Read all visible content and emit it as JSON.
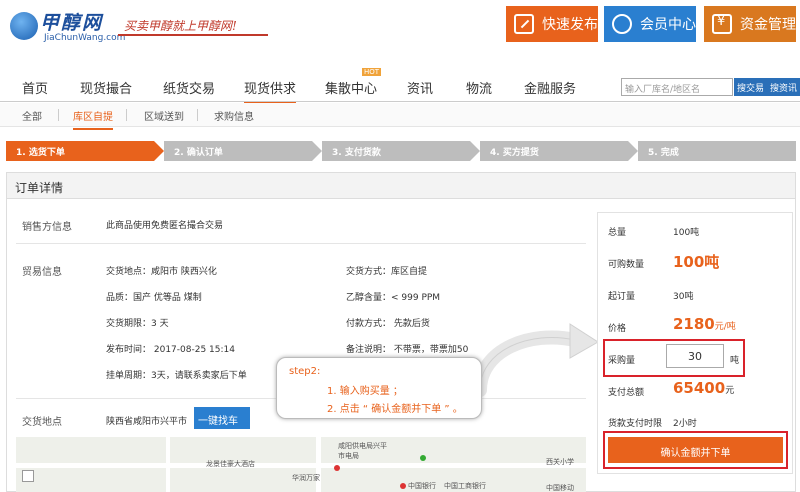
{
  "header": {
    "logo_text": "甲醇网",
    "logo_domain": "JiaChunWang.com",
    "slogan": "买卖甲醇就上甲醇网!",
    "buttons": [
      "快速发布",
      "会员中心",
      "资金管理"
    ]
  },
  "nav": {
    "items": [
      "首页",
      "现货撮合",
      "纸货交易",
      "现货供求",
      "集散中心",
      "资讯",
      "物流",
      "金融服务"
    ],
    "hot_badge": "HOT",
    "search_placeholder": "输入厂库名/地区名",
    "search_buttons": [
      "搜交易",
      "搜资讯"
    ]
  },
  "subnav": {
    "items": [
      "全部",
      "库区自提",
      "区域送到",
      "求购信息"
    ]
  },
  "steps": [
    "1. 选货下单",
    "2. 确认订单",
    "3. 支付货款",
    "4. 买方提货",
    "5. 完成"
  ],
  "order": {
    "title": "订单详情",
    "seller_label": "销售方信息",
    "seller_value": "此商品使用免费匿名撮合交易",
    "trade_label": "贸易信息",
    "fields_left": [
      "交货地点：咸阳市 陕西兴化",
      "品质：国产 优等品 煤制",
      "交货期限：3 天",
      "发布时间： 2017-08-25 15:14",
      "挂单周期：3天，请联系卖家后下单"
    ],
    "fields_right": [
      "交货方式：库区自提",
      "乙醇含量：< 999 PPM",
      "付款方式： 先款后货",
      "备注说明： 不带票，带票加50"
    ],
    "location_label": "交货地点",
    "location_value": "陕西省咸阳市兴平市",
    "find_car": "一键找车"
  },
  "map": {
    "labels": [
      "龙景佳豪大酒店",
      "咸阳供电局兴平市电局",
      "华润万家",
      "中国银行",
      "中国工商银行",
      "西关小学",
      "中国移动"
    ]
  },
  "callout": {
    "title": "step2:",
    "line1": "1. 输入购买量 ；",
    "line2": "2. 点击 “ 确认金额并下单 ” 。"
  },
  "summary": {
    "total_label": "总量",
    "total_value": "100吨",
    "available_label": "可购数量",
    "available_value": "100吨",
    "min_label": "起订量",
    "min_value": "30吨",
    "price_label": "价格",
    "price_value": "2180",
    "price_unit": "元/吨",
    "qty_label": "采购量",
    "qty_value": "30",
    "qty_unit": "吨",
    "amount_label": "支付总额",
    "amount_value": "65400",
    "amount_unit": "元",
    "deadline_label": "货款支付时限",
    "deadline_value": "2小时",
    "confirm_button": "确认金额并下单"
  },
  "colors": {
    "accent": "#e8621c",
    "blue": "#2a7fd0",
    "highlight_border": "#d9222a"
  }
}
